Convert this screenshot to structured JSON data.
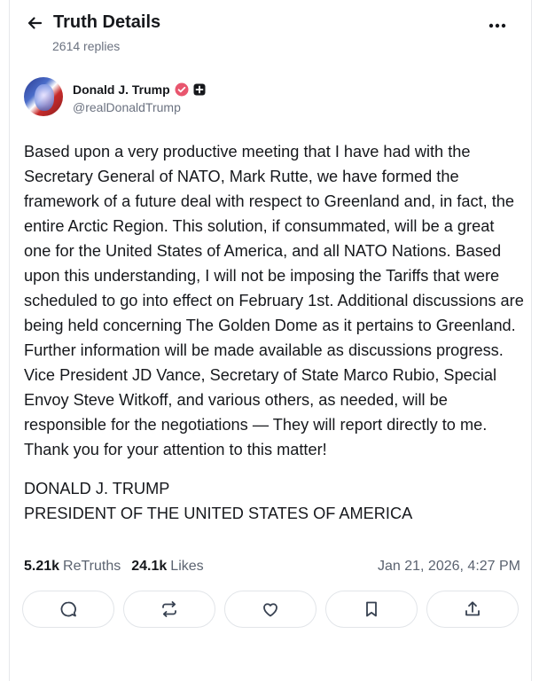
{
  "header": {
    "title": "Truth Details",
    "replies": "2614 replies"
  },
  "author": {
    "name": "Donald J. Trump",
    "handle": "@realDonaldTrump",
    "verified_color": "#e8566e"
  },
  "post": {
    "body": "Based upon a very productive meeting that I have had with the Secretary General of NATO, Mark Rutte, we have formed the framework of a future deal with respect to Greenland and, in fact, the entire Arctic Region. This solution, if consummated, will be a great one for the United States of America, and all NATO Nations. Based upon this understanding, I will not be imposing the Tariffs that were scheduled to go into effect on February 1st. Additional discussions are being held concerning The Golden Dome as it pertains to Greenland. Further information will be made available as discussions progress. Vice President JD Vance, Secretary of State Marco Rubio, Special Envoy Steve Witkoff, and various others, as needed, will be responsible for the negotiations — They will report directly to me. Thank you for your attention to this matter!",
    "signature_line1": "DONALD J. TRUMP",
    "signature_line2": "PRESIDENT OF THE UNITED STATES OF AMERICA"
  },
  "stats": {
    "retruths_count": "5.21k",
    "retruths_label": "ReTruths",
    "likes_count": "24.1k",
    "likes_label": "Likes",
    "timestamp": "Jan 21, 2026, 4:27 PM"
  },
  "actions": [
    {
      "icon": "reply-icon"
    },
    {
      "icon": "retruth-icon"
    },
    {
      "icon": "like-icon"
    },
    {
      "icon": "bookmark-icon"
    },
    {
      "icon": "share-icon"
    }
  ]
}
